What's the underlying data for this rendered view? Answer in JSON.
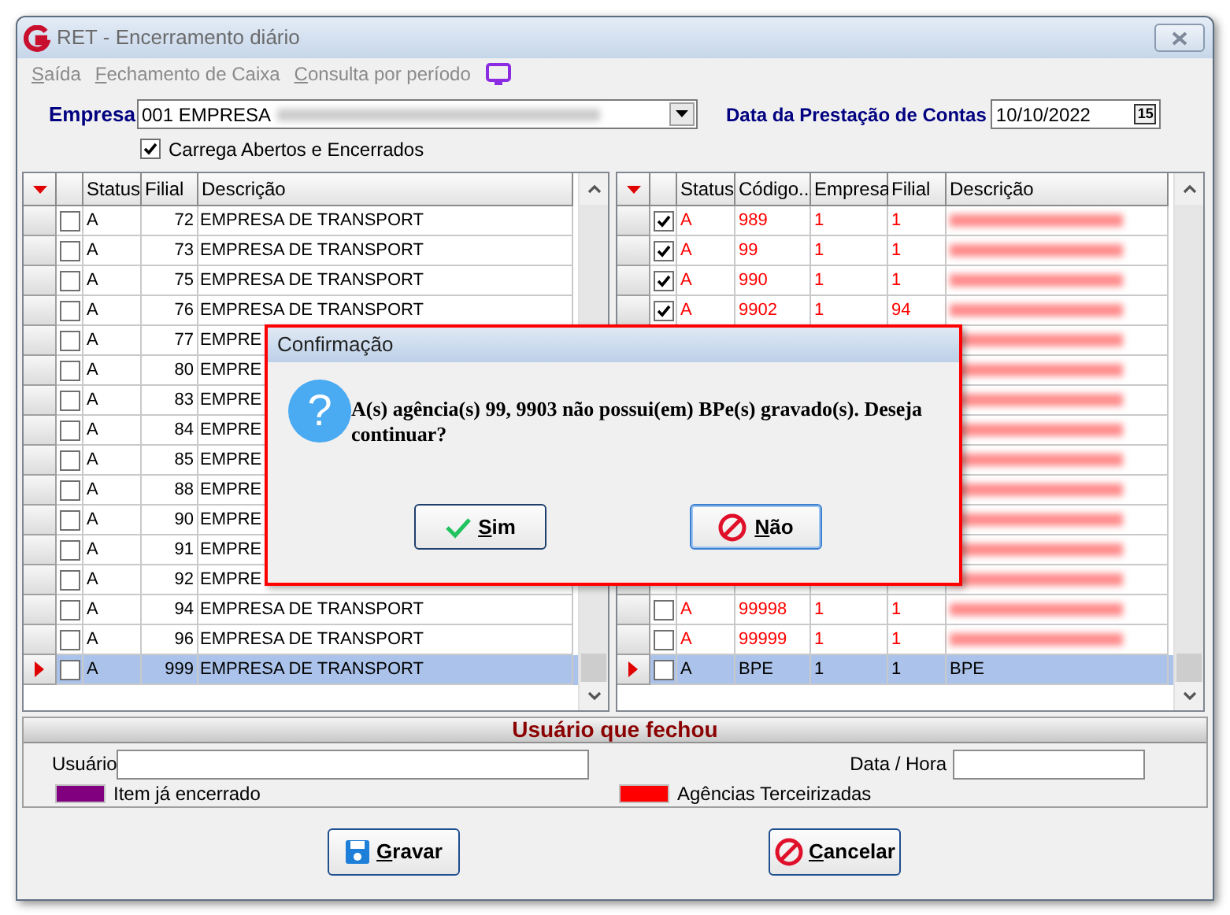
{
  "window": {
    "title": "RET - Encerramento diário"
  },
  "menu": [
    {
      "label": "Saída"
    },
    {
      "label": "Fechamento de Caixa"
    },
    {
      "label": "Consulta por período"
    }
  ],
  "empresa": {
    "label": "Empresa",
    "value": "001 EMPRESA"
  },
  "data_prestacao": {
    "label": "Data da Prestação de Contas",
    "value": "10/10/2022",
    "calendar_icon": "15"
  },
  "carrega": {
    "label": "Carrega Abertos e Encerrados",
    "checked": true
  },
  "left_grid": {
    "columns": [
      "Status",
      "Filial",
      "Descrição"
    ],
    "rows": [
      {
        "checked": false,
        "status": "A",
        "filial": "72",
        "description": "EMPRESA DE TRANSPORT",
        "selected": false
      },
      {
        "checked": false,
        "status": "A",
        "filial": "73",
        "description": "EMPRESA DE TRANSPORT",
        "selected": false
      },
      {
        "checked": false,
        "status": "A",
        "filial": "75",
        "description": "EMPRESA DE TRANSPORT",
        "selected": false
      },
      {
        "checked": false,
        "status": "A",
        "filial": "76",
        "description": "EMPRESA DE TRANSPORT",
        "selected": false
      },
      {
        "checked": false,
        "status": "A",
        "filial": "77",
        "description": "EMPRE",
        "selected": false
      },
      {
        "checked": false,
        "status": "A",
        "filial": "80",
        "description": "EMPRE",
        "selected": false
      },
      {
        "checked": false,
        "status": "A",
        "filial": "83",
        "description": "EMPRE",
        "selected": false
      },
      {
        "checked": false,
        "status": "A",
        "filial": "84",
        "description": "EMPRE",
        "selected": false
      },
      {
        "checked": false,
        "status": "A",
        "filial": "85",
        "description": "EMPRE",
        "selected": false
      },
      {
        "checked": false,
        "status": "A",
        "filial": "88",
        "description": "EMPRE",
        "selected": false
      },
      {
        "checked": false,
        "status": "A",
        "filial": "90",
        "description": "EMPRE",
        "selected": false
      },
      {
        "checked": false,
        "status": "A",
        "filial": "91",
        "description": "EMPRE",
        "selected": false
      },
      {
        "checked": false,
        "status": "A",
        "filial": "92",
        "description": "EMPRE",
        "selected": false
      },
      {
        "checked": false,
        "status": "A",
        "filial": "94",
        "description": "EMPRESA DE TRANSPORT",
        "selected": false
      },
      {
        "checked": false,
        "status": "A",
        "filial": "96",
        "description": "EMPRESA DE TRANSPORT",
        "selected": false
      },
      {
        "checked": false,
        "status": "A",
        "filial": "999",
        "description": "EMPRESA DE TRANSPORT",
        "selected": true
      }
    ]
  },
  "right_grid": {
    "columns": [
      "Status",
      "Código...",
      "Empresa",
      "Filial",
      "Descrição"
    ],
    "rows": [
      {
        "kind": "data",
        "checked": true,
        "status": "A",
        "codigo": "989",
        "empresa": "1",
        "filial": "1",
        "outsourced": true,
        "selected": false
      },
      {
        "kind": "data",
        "checked": true,
        "status": "A",
        "codigo": "99",
        "empresa": "1",
        "filial": "1",
        "outsourced": true,
        "selected": false
      },
      {
        "kind": "data",
        "checked": true,
        "status": "A",
        "codigo": "990",
        "empresa": "1",
        "filial": "1",
        "outsourced": true,
        "selected": false
      },
      {
        "kind": "data",
        "checked": true,
        "status": "A",
        "codigo": "9902",
        "empresa": "1",
        "filial": "94",
        "outsourced": true,
        "selected": false
      },
      {
        "kind": "covered",
        "outsourced": true
      },
      {
        "kind": "covered",
        "outsourced": true
      },
      {
        "kind": "covered",
        "outsourced": true
      },
      {
        "kind": "covered",
        "outsourced": true
      },
      {
        "kind": "covered",
        "outsourced": true
      },
      {
        "kind": "covered",
        "outsourced": true
      },
      {
        "kind": "covered",
        "outsourced": true
      },
      {
        "kind": "covered",
        "outsourced": true
      },
      {
        "kind": "covered",
        "outsourced": true
      },
      {
        "kind": "data",
        "checked": false,
        "status": "A",
        "codigo": "99998",
        "empresa": "1",
        "filial": "1",
        "outsourced": true,
        "selected": false
      },
      {
        "kind": "data",
        "checked": false,
        "status": "A",
        "codigo": "99999",
        "empresa": "1",
        "filial": "1",
        "outsourced": true,
        "selected": false
      },
      {
        "kind": "data",
        "checked": false,
        "status": "A",
        "codigo": "BPE",
        "empresa": "1",
        "filial": "1",
        "description": "BPE",
        "outsourced": false,
        "selected": true
      }
    ]
  },
  "user_section": {
    "title": "Usuário que fechou",
    "user_label": "Usuário",
    "date_label": "Data / Hora"
  },
  "legend": [
    {
      "label": "Item já encerrado",
      "color": "#800080"
    },
    {
      "label": "Agências Terceirizadas",
      "color": "#ff0000"
    }
  ],
  "buttons": [
    {
      "label": "Gravar",
      "kind": "save"
    },
    {
      "label": "Cancelar",
      "kind": "cancel"
    }
  ],
  "dialog": {
    "title": "Confirmação",
    "icon": "?",
    "message": "A(s) agência(s) 99, 9903 não possui(em) BPe(s) gravado(s). Deseja continuar?",
    "buttons": [
      {
        "label": "Sim",
        "kind": "yes",
        "focused": false
      },
      {
        "label": "Não",
        "kind": "no",
        "focused": true
      }
    ]
  }
}
